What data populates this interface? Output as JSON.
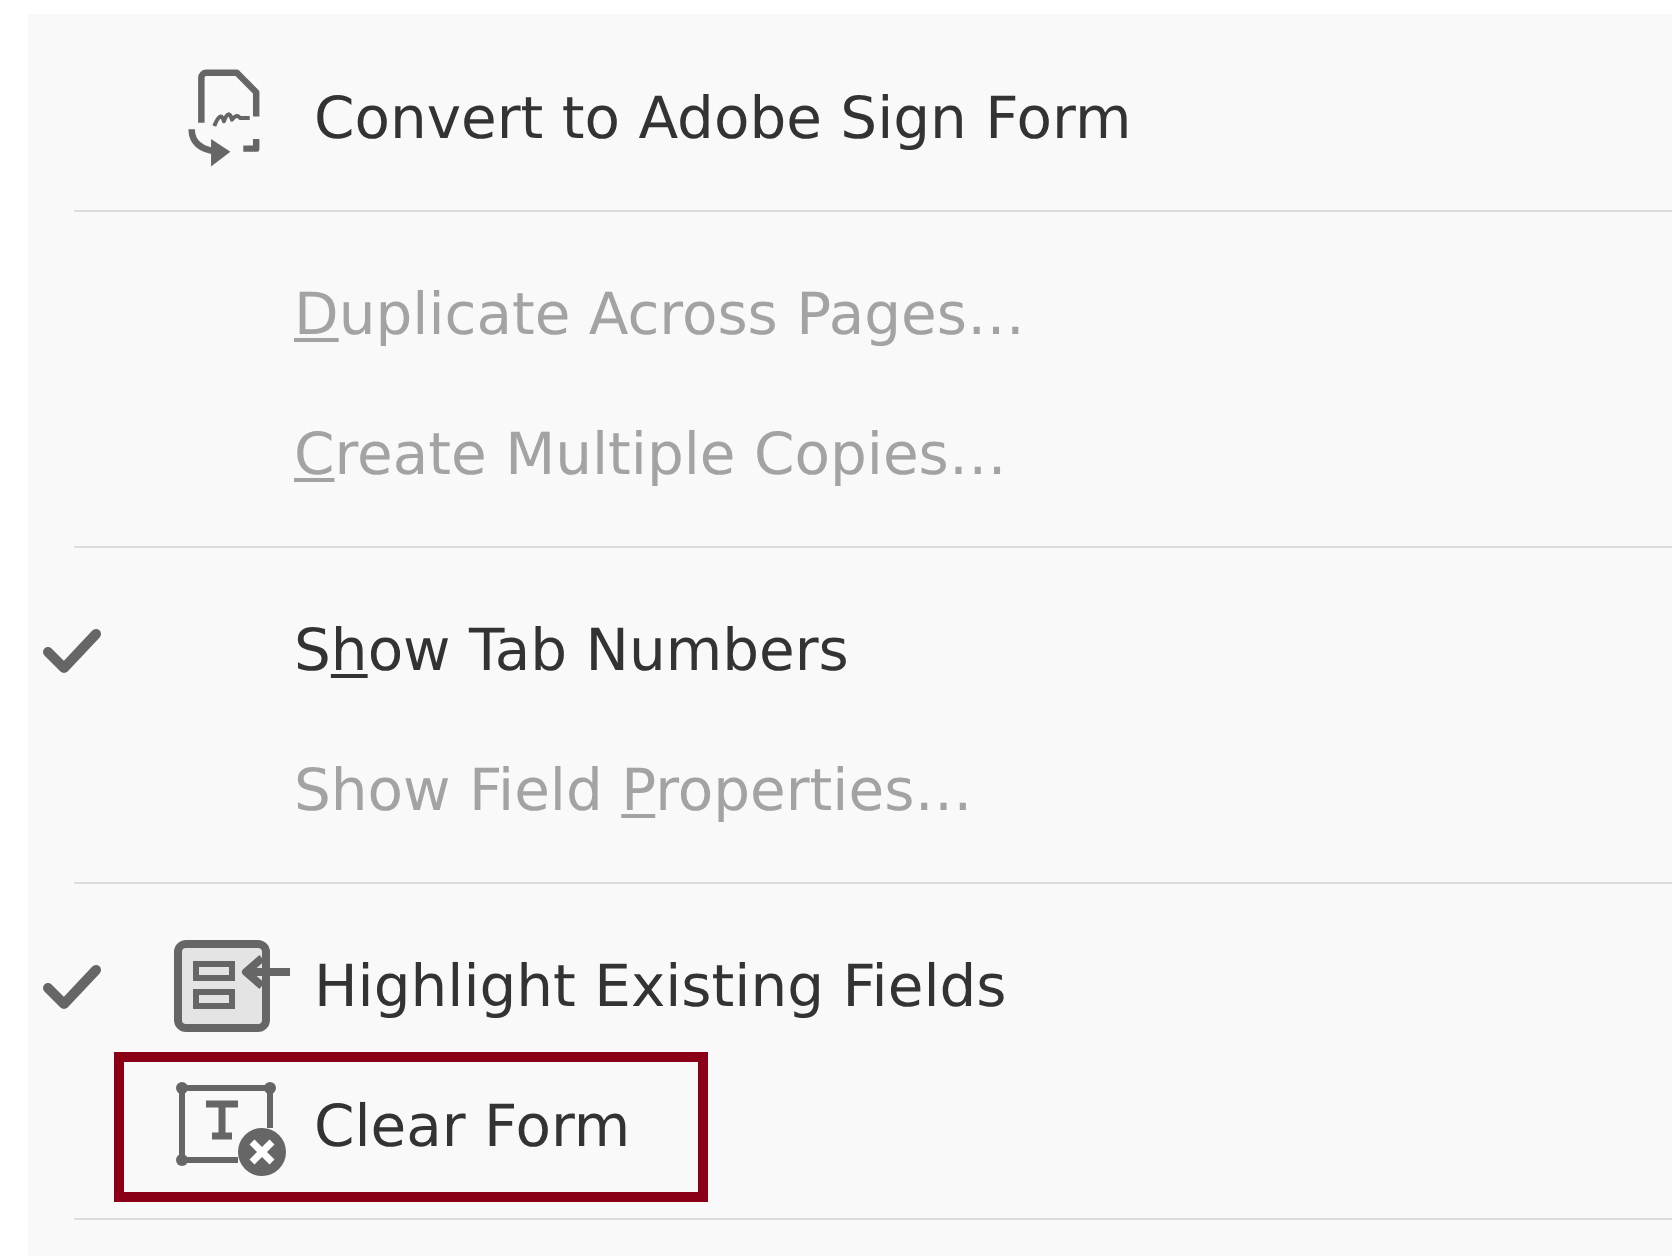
{
  "menu": {
    "items": [
      {
        "kind": "signing",
        "label": {
          "before": "Convert to Adobe Sign Form"
        },
        "checked": false,
        "disabled": false,
        "highlighted": false
      },
      {
        "kind": "separator"
      },
      {
        "kind": "item",
        "label": {
          "key": "D",
          "after": "uplicate Across Pages…"
        },
        "checked": false,
        "disabled": true,
        "highlighted": false
      },
      {
        "kind": "item",
        "label": {
          "key": "C",
          "after": "reate Multiple Copies…"
        },
        "checked": false,
        "disabled": true,
        "highlighted": false
      },
      {
        "kind": "separator"
      },
      {
        "kind": "item",
        "label": {
          "before": "S",
          "key": "h",
          "after": "ow Tab Numbers"
        },
        "checked": true,
        "disabled": false,
        "highlighted": false
      },
      {
        "kind": "item",
        "label": {
          "before": "Show Field ",
          "key": "P",
          "after": "roperties…"
        },
        "checked": false,
        "disabled": true,
        "highlighted": false
      },
      {
        "kind": "separator"
      },
      {
        "kind": "fields",
        "label": {
          "before": "Highlight Existing Fields"
        },
        "checked": true,
        "disabled": false,
        "highlighted": false
      },
      {
        "kind": "clearing",
        "label": {
          "before": "Clear Form"
        },
        "checked": false,
        "disabled": false,
        "highlighted": true
      },
      {
        "kind": "separator"
      }
    ]
  }
}
